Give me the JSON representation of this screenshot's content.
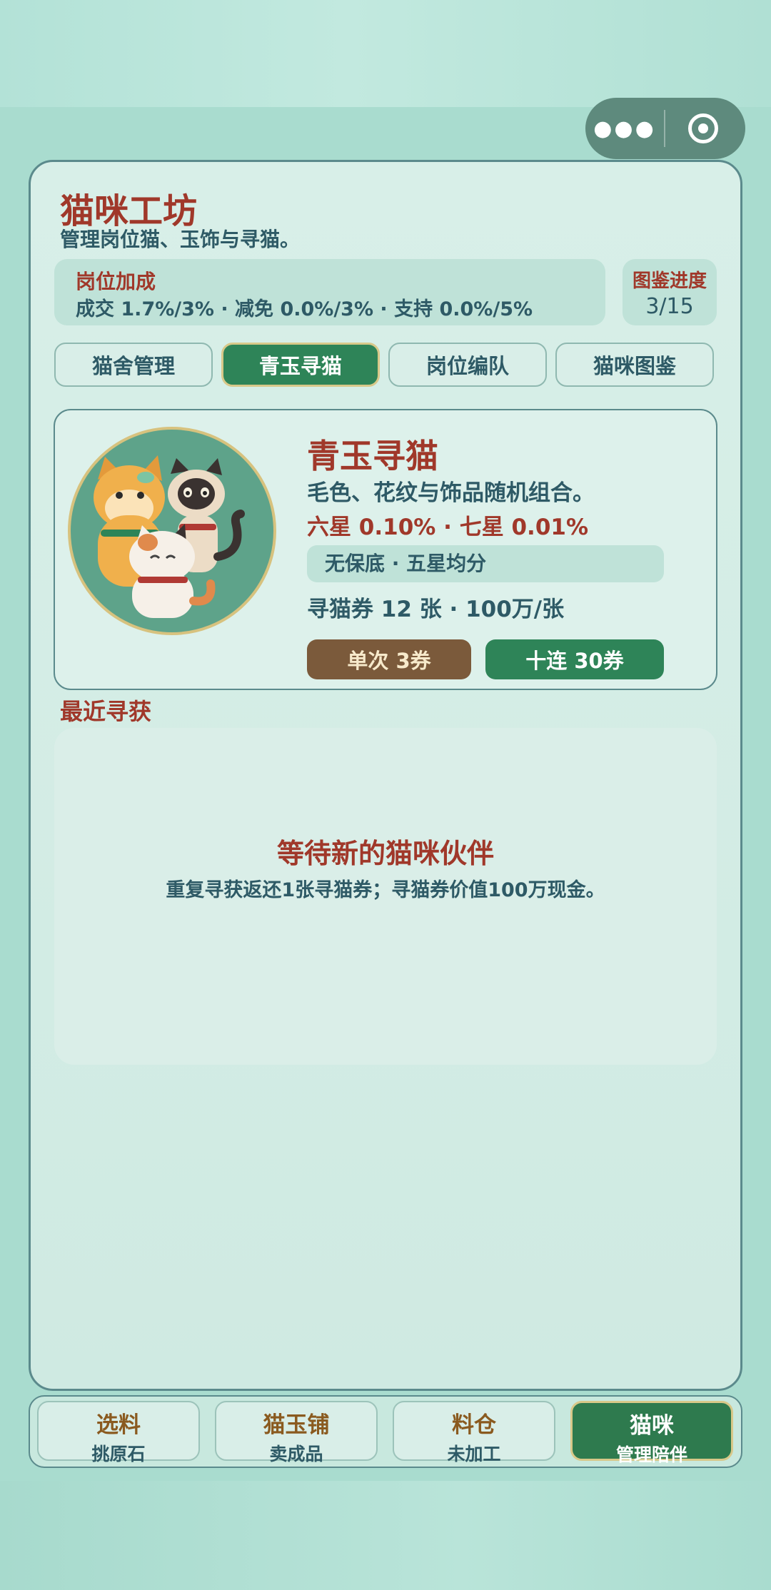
{
  "header": {
    "title": "猫咪工坊",
    "subtitle": "管理岗位猫、玉饰与寻猫。"
  },
  "bonus": {
    "heading": "岗位加成",
    "text": "成交 1.7%/3% · 减免 0.0%/3% · 支持 0.0%/5%"
  },
  "dex": {
    "heading": "图鉴进度",
    "value": "3/15"
  },
  "tabs": [
    {
      "label": "猫舍管理"
    },
    {
      "label": "青玉寻猫"
    },
    {
      "label": "岗位编队"
    },
    {
      "label": "猫咪图鉴"
    }
  ],
  "active_tab": "青玉寻猫",
  "gacha": {
    "title": "青玉寻猫",
    "desc": "毛色、花纹与饰品随机组合。",
    "rates": "六星 0.10% · 七星 0.01%",
    "pity": "无保底 · 五星均分",
    "tickets": "寻猫券 12 张 · 100万/张",
    "single_label": "单次 3券",
    "ten_label": "十连 30券"
  },
  "recent": {
    "heading": "最近寻获",
    "empty_title": "等待新的猫咪伙伴",
    "empty_text": "重复寻获返还1张寻猫券；寻猫券价值100万现金。"
  },
  "nav": [
    {
      "main": "选料",
      "sub": "挑原石"
    },
    {
      "main": "猫玉铺",
      "sub": "卖成品"
    },
    {
      "main": "料仓",
      "sub": "未加工"
    },
    {
      "main": "猫咪",
      "sub": "管理陪伴"
    }
  ],
  "colors": {
    "accent_red": "#a0382a",
    "accent_green": "#2e8458",
    "text_teal": "#2e5a66",
    "brown_button": "#7b5a3b"
  }
}
